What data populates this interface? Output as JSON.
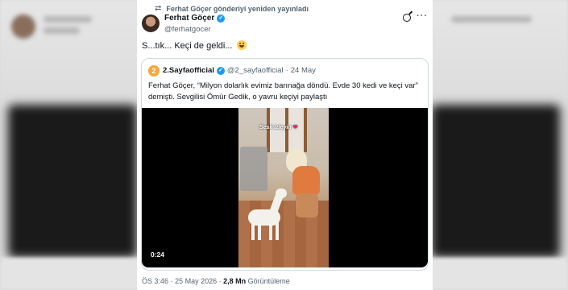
{
  "repost": {
    "text": "Ferhat Göçer gönderiyi yeniden yayınladı",
    "icon": "repost-icon"
  },
  "author": {
    "name": "Ferhat Göçer",
    "handle": "@ferhatgocer",
    "verified_icon": "verified-badge-icon"
  },
  "tweet": {
    "text": "S...tık... Keçi de geldi...",
    "emoji": "grinning-face-emoji"
  },
  "quote": {
    "avatar_text": "2",
    "name": "2.Sayfaofficial",
    "handle": "@2_sayfaofficial",
    "separator": "·",
    "date": "24 May",
    "text": "Ferhat Göçer, “Milyon dolarlık evimiz barınağa döndü. Evde 30 kedi ve keçi var” demişti. Sevgilisi Ömür Gedik, o yavru keçiyi paylaştı",
    "video": {
      "overlay_caption": "Sesli izleyin",
      "duration": "0:24"
    }
  },
  "meta": {
    "time": "ÖS 3:46",
    "separator": "·",
    "date": "25 May 2026",
    "views_count": "2,8 Mn",
    "views_label": "Görüntüleme"
  },
  "colors": {
    "accent": "#1d9bf0",
    "text": "#0f1419",
    "secondary": "#536471",
    "border": "#cfd9de"
  }
}
